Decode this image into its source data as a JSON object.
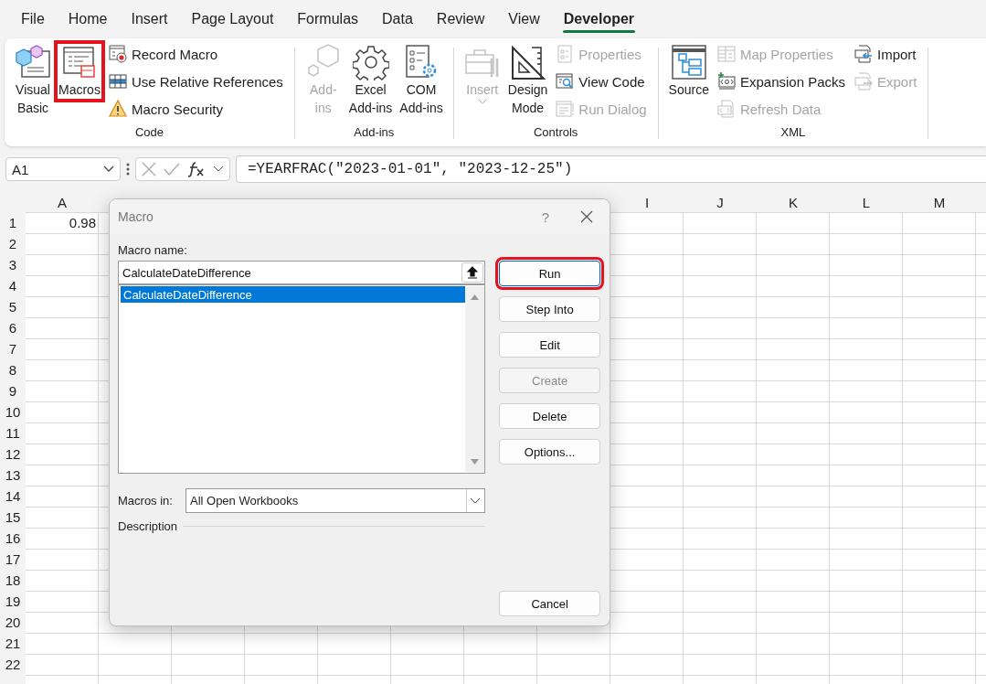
{
  "menu_tabs": [
    {
      "label": "File",
      "selected": false
    },
    {
      "label": "Home",
      "selected": false
    },
    {
      "label": "Insert",
      "selected": false
    },
    {
      "label": "Page Layout",
      "selected": false
    },
    {
      "label": "Formulas",
      "selected": false
    },
    {
      "label": "Data",
      "selected": false
    },
    {
      "label": "Review",
      "selected": false
    },
    {
      "label": "View",
      "selected": false
    },
    {
      "label": "Developer",
      "selected": true
    }
  ],
  "ribbon": {
    "groups": [
      {
        "label": "Code",
        "items": [
          {
            "kind": "large",
            "label": "Visual\nBasic",
            "disabled": false,
            "highlighted": false
          },
          {
            "kind": "large",
            "label": "Macros",
            "disabled": false,
            "highlighted": true
          },
          {
            "kind": "stack",
            "items": [
              {
                "label": "Record Macro",
                "disabled": false
              },
              {
                "label": "Use Relative References",
                "disabled": false
              },
              {
                "label": "Macro Security",
                "disabled": false
              }
            ]
          }
        ]
      },
      {
        "label": "Add-ins",
        "items": [
          {
            "kind": "large",
            "label": "Add-\nins",
            "disabled": true,
            "highlighted": false
          },
          {
            "kind": "large",
            "label": "Excel\nAdd-ins",
            "disabled": false,
            "highlighted": false
          },
          {
            "kind": "large",
            "label": "COM\nAdd-ins",
            "disabled": false,
            "highlighted": false
          }
        ]
      },
      {
        "label": "Controls",
        "items": [
          {
            "kind": "large",
            "label": "Insert",
            "disabled": true,
            "highlighted": false,
            "dropdown": true
          },
          {
            "kind": "large",
            "label": "Design\nMode",
            "disabled": false,
            "highlighted": false
          },
          {
            "kind": "stack",
            "items": [
              {
                "label": "Properties",
                "disabled": true
              },
              {
                "label": "View Code",
                "disabled": false
              },
              {
                "label": "Run Dialog",
                "disabled": true
              }
            ]
          }
        ]
      },
      {
        "label": "XML",
        "items": [
          {
            "kind": "large",
            "label": "Source",
            "disabled": false,
            "highlighted": false
          },
          {
            "kind": "stack",
            "items": [
              {
                "label": "Map Properties",
                "disabled": true
              },
              {
                "label": "Expansion Packs",
                "disabled": false
              },
              {
                "label": "Refresh Data",
                "disabled": true
              }
            ]
          },
          {
            "kind": "stack",
            "items": [
              {
                "label": "Import",
                "disabled": false
              },
              {
                "label": "Export",
                "disabled": true
              }
            ]
          }
        ]
      }
    ]
  },
  "formula_bar": {
    "name_box": "A1",
    "formula": "=YEARFRAC(\"2023-01-01\", \"2023-12-25\")"
  },
  "sheet": {
    "columns": [
      "A",
      "",
      "",
      "",
      "",
      "",
      "",
      "",
      "I",
      "J",
      "K",
      "L",
      "M"
    ],
    "rows": [
      {
        "label": "1",
        "cells": [
          "0.98"
        ]
      },
      {
        "label": "2"
      },
      {
        "label": "3"
      },
      {
        "label": "4"
      },
      {
        "label": "5"
      },
      {
        "label": "6"
      },
      {
        "label": "7"
      },
      {
        "label": "8"
      },
      {
        "label": "9"
      },
      {
        "label": "10"
      },
      {
        "label": "11"
      },
      {
        "label": "12"
      },
      {
        "label": "13"
      },
      {
        "label": "14"
      },
      {
        "label": "15"
      },
      {
        "label": "16"
      },
      {
        "label": "17"
      },
      {
        "label": "18"
      },
      {
        "label": "19"
      },
      {
        "label": "20"
      },
      {
        "label": "21"
      },
      {
        "label": "22"
      }
    ]
  },
  "dialog": {
    "title": "Macro",
    "help": "?",
    "name_label": "Macro name:",
    "name_value": "CalculateDateDifference",
    "macros": [
      {
        "label": "CalculateDateDifference",
        "selected": true
      }
    ],
    "buttons": [
      {
        "label": "Run",
        "disabled": false,
        "highlighted": true,
        "focused": true
      },
      {
        "label": "Step Into",
        "disabled": false,
        "highlighted": false,
        "focused": false
      },
      {
        "label": "Edit",
        "disabled": false,
        "highlighted": false,
        "focused": false
      },
      {
        "label": "Create",
        "disabled": true,
        "highlighted": false,
        "focused": false
      },
      {
        "label": "Delete",
        "disabled": false,
        "highlighted": false,
        "focused": false
      },
      {
        "label": "Options...",
        "disabled": false,
        "highlighted": false,
        "focused": false
      }
    ],
    "macros_in_label": "Macros in:",
    "macros_in_value": "All Open Workbooks",
    "description_label": "Description",
    "cancel": "Cancel"
  }
}
